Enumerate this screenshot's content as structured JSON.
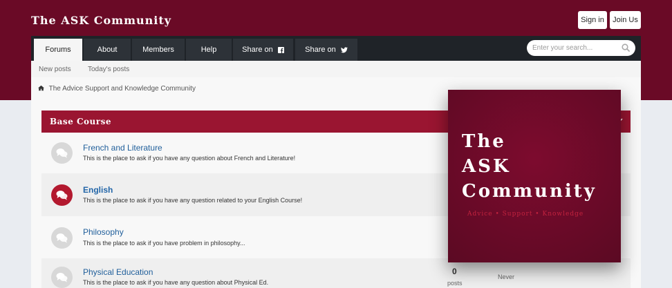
{
  "site": {
    "title": "The ASK Community"
  },
  "auth": {
    "sign_in": "Sign in",
    "join": "Join Us"
  },
  "nav": {
    "tabs": [
      {
        "label": "Forums",
        "active": true
      },
      {
        "label": "About"
      },
      {
        "label": "Members"
      },
      {
        "label": "Help"
      },
      {
        "label": "Share on",
        "icon": "facebook-icon"
      },
      {
        "label": "Share on",
        "icon": "twitter-icon"
      }
    ]
  },
  "search": {
    "placeholder": "Enter your search..."
  },
  "subnav": {
    "items": [
      "New posts",
      "Today's posts"
    ]
  },
  "breadcrumb": {
    "label": "The Advice Support and Knowledge Community"
  },
  "category": {
    "title": "Base Course"
  },
  "forums": [
    {
      "title": "French and Literature",
      "description": "This is the place to ask if you have any question about French and Literature!",
      "unread": false
    },
    {
      "title": "English",
      "description": "This is the place to ask if you have any question related to your English Course!",
      "unread": true
    },
    {
      "title": "Philosophy",
      "description": "This is the place to ask if you have problem in philosophy...",
      "unread": false
    },
    {
      "title": "Physical Education",
      "description": "This is the place to ask if you have any question about Physical Ed.",
      "unread": false,
      "posts_count": "0",
      "posts_label": "posts",
      "last_post": "Never"
    }
  ],
  "logo": {
    "line1": "The",
    "line2": "ASK",
    "line3": "Community",
    "tagline": "Advice • Support • Knowledge"
  },
  "colors": {
    "brand": "#6a0a26",
    "category_bar": "#9a1531",
    "link": "#1f5e9a",
    "nav_dark": "#1f2328"
  }
}
